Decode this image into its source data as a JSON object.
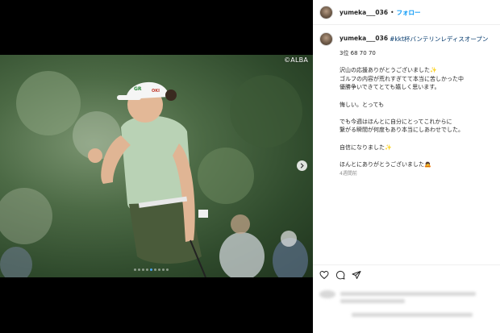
{
  "photo": {
    "watermark": "©ALBA",
    "carousel_total": 9,
    "carousel_active_index": 4,
    "cap_text": "GR",
    "cap_brand": "OKI"
  },
  "header": {
    "username": "yumeka___036",
    "separator": "•",
    "follow_label": "フォロー"
  },
  "caption": {
    "username": "yumeka___036",
    "hashtag": "#kkt杯バンテリンレディスオープン",
    "lines": [
      "3位 68 70 70",
      "",
      "沢山の応援ありがとうございました✨",
      "ゴルフの内容が荒れすぎてて本当に苦しかった中",
      "優勝争いできてとても嬉しく思います。",
      "",
      "悔しい。とっても",
      "",
      "でも今週はほんとに自分にとってこれからに",
      "繋がる瞬間が何度もあり本当にしあわせでした。",
      "",
      "自信になりました✨",
      "",
      "ほんとにありがとうございました🙇"
    ],
    "timestamp": "4週間前"
  },
  "actions": [
    "heart-icon",
    "comment-icon",
    "share-icon"
  ],
  "colors": {
    "follow_blue": "#0095f6",
    "hashtag_blue": "#00376b",
    "text": "#262626",
    "muted": "#8e8e8e"
  }
}
